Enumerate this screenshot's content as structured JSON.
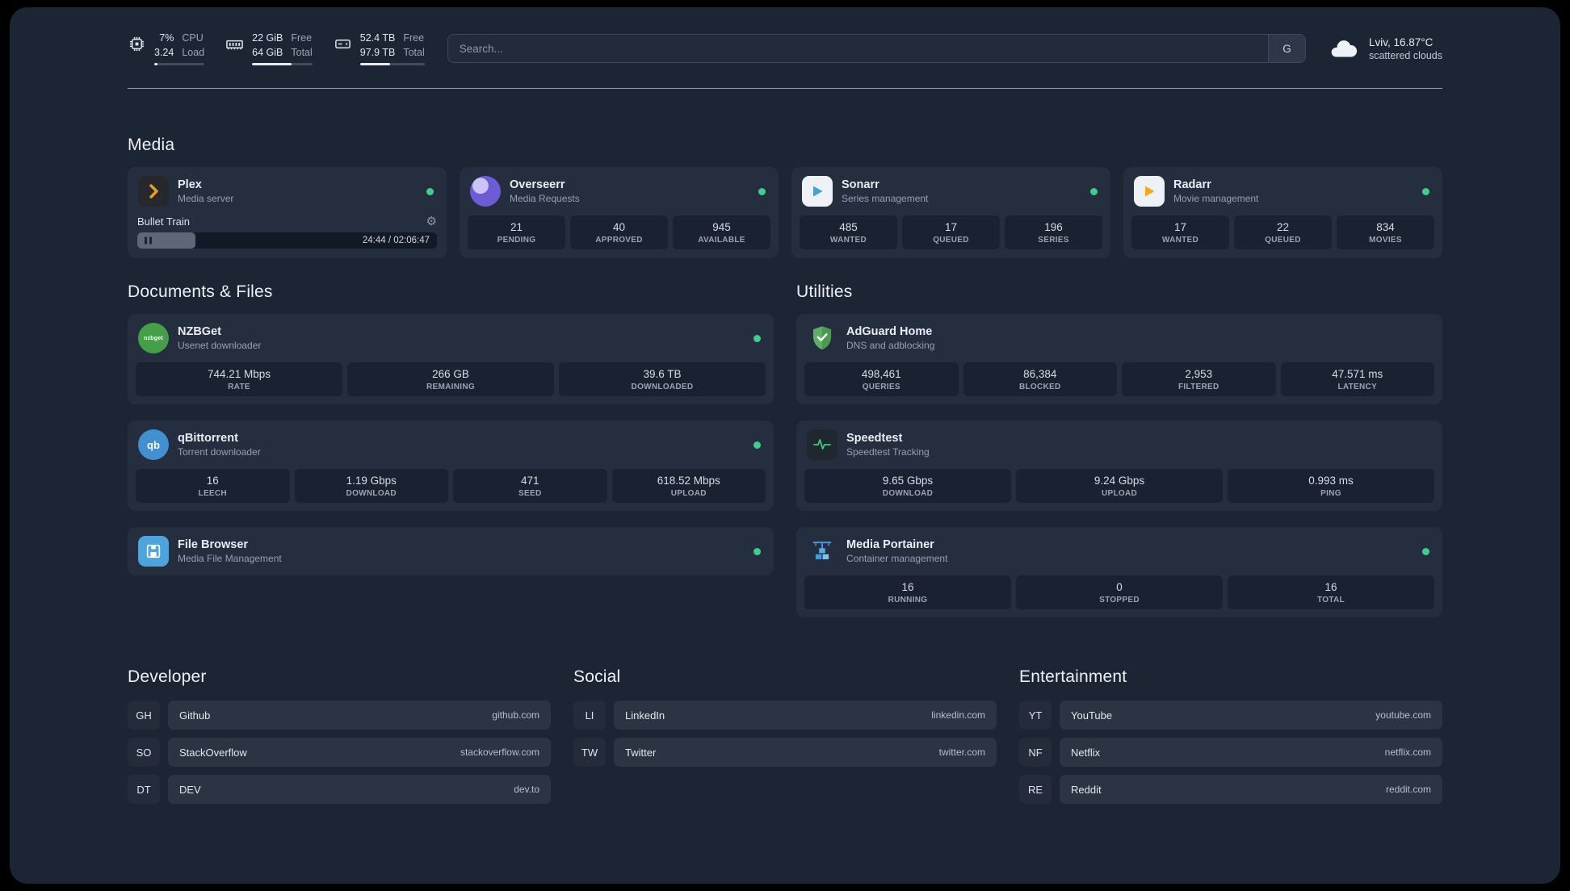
{
  "colors": {
    "background": "#1c2534",
    "card": "#242e3e",
    "tile": "#1a2231",
    "status_online": "#3ecf8e",
    "plex_gold": "#e8a021",
    "sonarr_blue": "#38a5dc",
    "radarr_gold": "#f6a81c",
    "nzbget_green": "#43a047",
    "adguard_green": "#5fae63",
    "portainer_blue": "#3f9bd8"
  },
  "topbar": {
    "cpu": {
      "value1": "7%",
      "value2": "3.24",
      "label1": "CPU",
      "label2": "Load",
      "percent": 7
    },
    "memory": {
      "value1": "22 GiB",
      "value2": "64 GiB",
      "label1": "Free",
      "label2": "Total",
      "percent": 66
    },
    "disk": {
      "value1": "52.4 TB",
      "value2": "97.9 TB",
      "label1": "Free",
      "label2": "Total",
      "percent": 46
    },
    "search": {
      "placeholder": "Search...",
      "button": "G"
    },
    "weather": {
      "location": "Lviv, 16.87°C",
      "condition": "scattered clouds"
    }
  },
  "sections": {
    "media": "Media",
    "documents": "Documents & Files",
    "utilities": "Utilities",
    "developer": "Developer",
    "social": "Social",
    "entertainment": "Entertainment"
  },
  "services": {
    "plex": {
      "title": "Plex",
      "subtitle": "Media server",
      "now_playing": "Bullet Train",
      "time": "24:44 / 02:06:47",
      "progress_percent": 19.5
    },
    "overseerr": {
      "title": "Overseerr",
      "subtitle": "Media Requests",
      "stats": [
        {
          "value": "21",
          "label": "PENDING"
        },
        {
          "value": "40",
          "label": "APPROVED"
        },
        {
          "value": "945",
          "label": "AVAILABLE"
        }
      ]
    },
    "sonarr": {
      "title": "Sonarr",
      "subtitle": "Series management",
      "stats": [
        {
          "value": "485",
          "label": "WANTED"
        },
        {
          "value": "17",
          "label": "QUEUED"
        },
        {
          "value": "196",
          "label": "SERIES"
        }
      ]
    },
    "radarr": {
      "title": "Radarr",
      "subtitle": "Movie management",
      "stats": [
        {
          "value": "17",
          "label": "WANTED"
        },
        {
          "value": "22",
          "label": "QUEUED"
        },
        {
          "value": "834",
          "label": "MOVIES"
        }
      ]
    },
    "nzbget": {
      "title": "NZBGet",
      "subtitle": "Usenet downloader",
      "icon_text": "nzbget",
      "stats": [
        {
          "value": "744.21 Mbps",
          "label": "RATE"
        },
        {
          "value": "266 GB",
          "label": "REMAINING"
        },
        {
          "value": "39.6 TB",
          "label": "DOWNLOADED"
        }
      ]
    },
    "qbittorrent": {
      "title": "qBittorrent",
      "subtitle": "Torrent downloader",
      "icon_text": "qb",
      "stats": [
        {
          "value": "16",
          "label": "LEECH"
        },
        {
          "value": "1.19 Gbps",
          "label": "DOWNLOAD"
        },
        {
          "value": "471",
          "label": "SEED"
        },
        {
          "value": "618.52 Mbps",
          "label": "UPLOAD"
        }
      ]
    },
    "filebrowser": {
      "title": "File Browser",
      "subtitle": "Media File Management"
    },
    "adguard": {
      "title": "AdGuard Home",
      "subtitle": "DNS and adblocking",
      "stats": [
        {
          "value": "498,461",
          "label": "QUERIES"
        },
        {
          "value": "86,384",
          "label": "BLOCKED"
        },
        {
          "value": "2,953",
          "label": "FILTERED"
        },
        {
          "value": "47.571 ms",
          "label": "LATENCY"
        }
      ]
    },
    "speedtest": {
      "title": "Speedtest",
      "subtitle": "Speedtest Tracking",
      "stats": [
        {
          "value": "9.65 Gbps",
          "label": "DOWNLOAD"
        },
        {
          "value": "9.24 Gbps",
          "label": "UPLOAD"
        },
        {
          "value": "0.993 ms",
          "label": "PING"
        }
      ]
    },
    "portainer": {
      "title": "Media Portainer",
      "subtitle": "Container management",
      "stats": [
        {
          "value": "16",
          "label": "RUNNING"
        },
        {
          "value": "0",
          "label": "STOPPED"
        },
        {
          "value": "16",
          "label": "TOTAL"
        }
      ]
    }
  },
  "bookmarks": {
    "developer": [
      {
        "abbr": "GH",
        "name": "Github",
        "domain": "github.com"
      },
      {
        "abbr": "SO",
        "name": "StackOverflow",
        "domain": "stackoverflow.com"
      },
      {
        "abbr": "DT",
        "name": "DEV",
        "domain": "dev.to"
      }
    ],
    "social": [
      {
        "abbr": "LI",
        "name": "LinkedIn",
        "domain": "linkedin.com"
      },
      {
        "abbr": "TW",
        "name": "Twitter",
        "domain": "twitter.com"
      }
    ],
    "entertainment": [
      {
        "abbr": "YT",
        "name": "YouTube",
        "domain": "youtube.com"
      },
      {
        "abbr": "NF",
        "name": "Netflix",
        "domain": "netflix.com"
      },
      {
        "abbr": "RE",
        "name": "Reddit",
        "domain": "reddit.com"
      }
    ]
  }
}
